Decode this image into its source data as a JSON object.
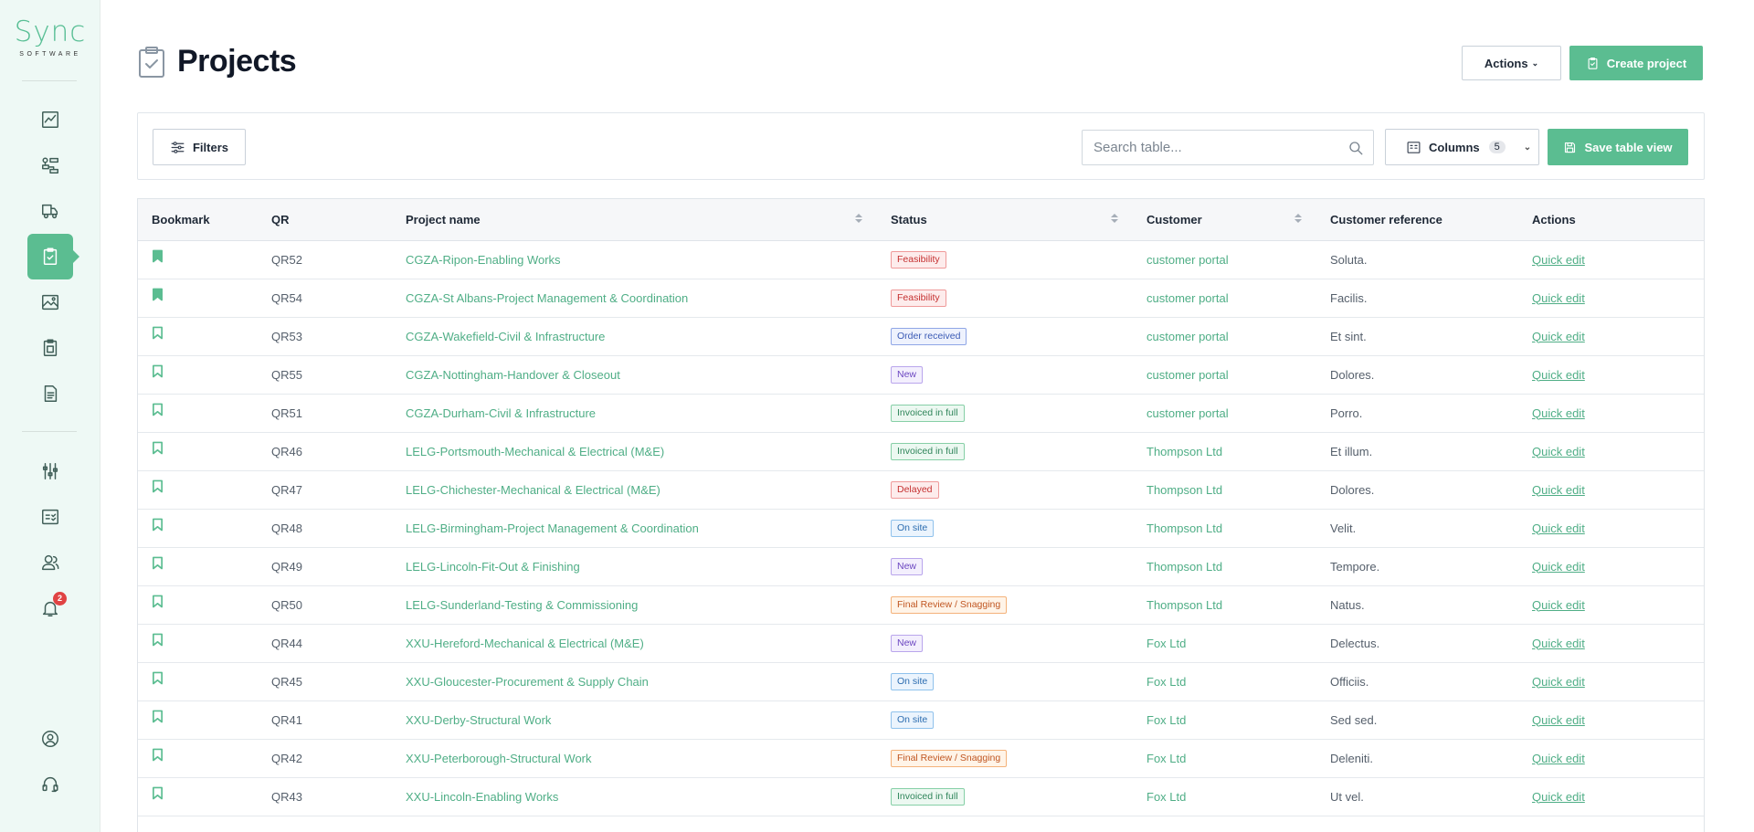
{
  "brand": {
    "name": "Sync",
    "tagline": "SOFTWARE",
    "accent": "#5bbd91"
  },
  "sidebar": {
    "items": [
      {
        "name": "dashboard-icon"
      },
      {
        "name": "workflow-icon"
      },
      {
        "name": "delivery-icon"
      },
      {
        "name": "projects-icon",
        "active": true
      },
      {
        "name": "gallery-icon"
      },
      {
        "name": "checklist-icon"
      },
      {
        "name": "documents-icon"
      },
      {
        "name": "settings-sliders-icon"
      },
      {
        "name": "tasks-icon"
      },
      {
        "name": "users-icon"
      },
      {
        "name": "notifications-icon",
        "badge": "2"
      },
      {
        "name": "account-icon"
      },
      {
        "name": "support-icon"
      }
    ]
  },
  "header": {
    "title": "Projects",
    "actions_label": "Actions",
    "create_label": "Create project"
  },
  "toolbar": {
    "filters_label": "Filters",
    "search_placeholder": "Search table...",
    "columns_label": "Columns",
    "columns_count": "5",
    "save_label": "Save table view"
  },
  "table": {
    "columns": [
      "Bookmark",
      "QR",
      "Project name",
      "Status",
      "Customer",
      "Customer reference",
      "Actions"
    ],
    "quick_edit_label": "Quick edit",
    "status_colors": {
      "Feasibility": {
        "fg": "#c53030",
        "bg": "#fdecec",
        "border": "#ef9a9a"
      },
      "Order received": {
        "fg": "#3b5bb5",
        "bg": "#eef2fd",
        "border": "#8fa6e6"
      },
      "New": {
        "fg": "#6b46c1",
        "bg": "#f3effd",
        "border": "#b9a5ec"
      },
      "Invoiced in full": {
        "fg": "#2f855a",
        "bg": "#ecf8f1",
        "border": "#86cfa6"
      },
      "Delayed": {
        "fg": "#c53030",
        "bg": "#fdecec",
        "border": "#ef9a9a"
      },
      "On site": {
        "fg": "#2b6cb0",
        "bg": "#ebf4fd",
        "border": "#90c2ec"
      },
      "Final Review / Snagging": {
        "fg": "#c05621",
        "bg": "#fff4e8",
        "border": "#f4b27a"
      }
    },
    "rows": [
      {
        "bookmarked": true,
        "qr": "QR52",
        "project": "CGZA-Ripon-Enabling Works",
        "status": "Feasibility",
        "customer": "customer portal",
        "ref": "Soluta."
      },
      {
        "bookmarked": true,
        "qr": "QR54",
        "project": "CGZA-St Albans-Project Management & Coordination",
        "status": "Feasibility",
        "customer": "customer portal",
        "ref": "Facilis."
      },
      {
        "bookmarked": false,
        "qr": "QR53",
        "project": "CGZA-Wakefield-Civil & Infrastructure",
        "status": "Order received",
        "customer": "customer portal",
        "ref": "Et sint."
      },
      {
        "bookmarked": false,
        "qr": "QR55",
        "project": "CGZA-Nottingham-Handover & Closeout",
        "status": "New",
        "customer": "customer portal",
        "ref": "Dolores."
      },
      {
        "bookmarked": false,
        "qr": "QR51",
        "project": "CGZA-Durham-Civil & Infrastructure",
        "status": "Invoiced in full",
        "customer": "customer portal",
        "ref": "Porro."
      },
      {
        "bookmarked": false,
        "qr": "QR46",
        "project": "LELG-Portsmouth-Mechanical & Electrical (M&E)",
        "status": "Invoiced in full",
        "customer": "Thompson Ltd",
        "ref": "Et illum."
      },
      {
        "bookmarked": false,
        "qr": "QR47",
        "project": "LELG-Chichester-Mechanical & Electrical (M&E)",
        "status": "Delayed",
        "customer": "Thompson Ltd",
        "ref": "Dolores."
      },
      {
        "bookmarked": false,
        "qr": "QR48",
        "project": "LELG-Birmingham-Project Management & Coordination",
        "status": "On site",
        "customer": "Thompson Ltd",
        "ref": "Velit."
      },
      {
        "bookmarked": false,
        "qr": "QR49",
        "project": "LELG-Lincoln-Fit-Out & Finishing",
        "status": "New",
        "customer": "Thompson Ltd",
        "ref": "Tempore."
      },
      {
        "bookmarked": false,
        "qr": "QR50",
        "project": "LELG-Sunderland-Testing & Commissioning",
        "status": "Final Review / Snagging",
        "customer": "Thompson Ltd",
        "ref": "Natus."
      },
      {
        "bookmarked": false,
        "qr": "QR44",
        "project": "XXU-Hereford-Mechanical & Electrical (M&E)",
        "status": "New",
        "customer": "Fox Ltd",
        "ref": "Delectus."
      },
      {
        "bookmarked": false,
        "qr": "QR45",
        "project": "XXU-Gloucester-Procurement & Supply Chain",
        "status": "On site",
        "customer": "Fox Ltd",
        "ref": "Officiis."
      },
      {
        "bookmarked": false,
        "qr": "QR41",
        "project": "XXU-Derby-Structural Work",
        "status": "On site",
        "customer": "Fox Ltd",
        "ref": "Sed sed."
      },
      {
        "bookmarked": false,
        "qr": "QR42",
        "project": "XXU-Peterborough-Structural Work",
        "status": "Final Review / Snagging",
        "customer": "Fox Ltd",
        "ref": "Deleniti."
      },
      {
        "bookmarked": false,
        "qr": "QR43",
        "project": "XXU-Lincoln-Enabling Works",
        "status": "Invoiced in full",
        "customer": "Fox Ltd",
        "ref": "Ut vel."
      }
    ]
  }
}
